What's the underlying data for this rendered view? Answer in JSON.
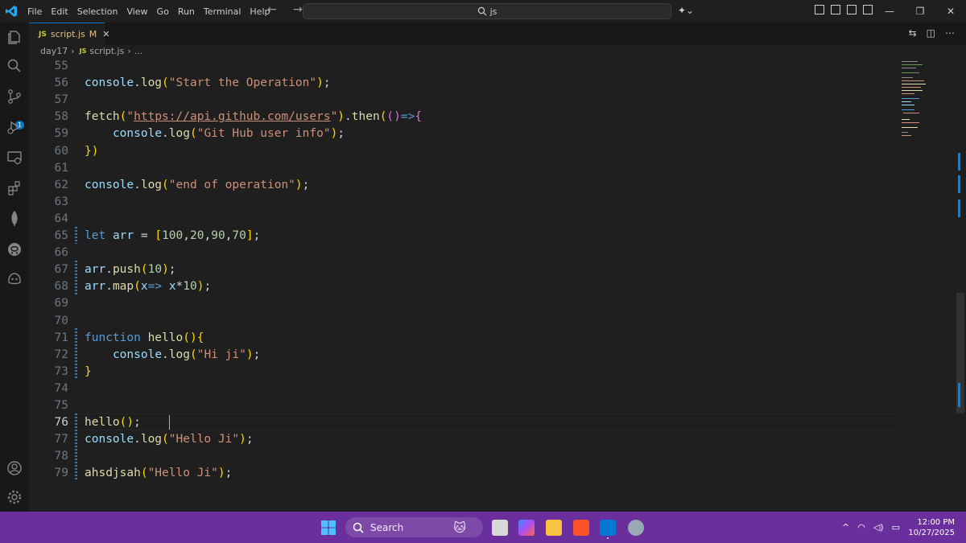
{
  "titlebar": {
    "menu": [
      "File",
      "Edit",
      "Selection",
      "View",
      "Go",
      "Run",
      "Terminal",
      "Help"
    ],
    "command_center": "js",
    "nav_arrows": "← →"
  },
  "activitybar": {
    "items": [
      "explorer-icon",
      "search-icon",
      "source-control-icon",
      "run-debug-icon",
      "remote-explorer-icon",
      "extensions-icon",
      "mongodb-icon",
      "github-icon",
      "copilot-icon"
    ],
    "scm_badge": "1",
    "bottom": [
      "account-icon",
      "settings-icon"
    ]
  },
  "tab": {
    "icon_label": "JS",
    "name": "script.js",
    "status": "M",
    "close": "✕"
  },
  "breadcrumb": {
    "folder": "day17",
    "icon_label": "JS",
    "file": "script.js",
    "more": "..."
  },
  "editor": {
    "active_line": 76,
    "lines": [
      {
        "n": 55,
        "t": ""
      },
      {
        "n": 56,
        "t": "console.log(\"Start the Operation\");"
      },
      {
        "n": 57,
        "t": ""
      },
      {
        "n": 58,
        "t": "fetch(\"https://api.github.com/users\").then(()=>{"
      },
      {
        "n": 59,
        "t": "    console.log(\"Git Hub user info\");"
      },
      {
        "n": 60,
        "t": "})"
      },
      {
        "n": 61,
        "t": ""
      },
      {
        "n": 62,
        "t": "console.log(\"end of operation\");"
      },
      {
        "n": 63,
        "t": ""
      },
      {
        "n": 64,
        "t": ""
      },
      {
        "n": 65,
        "t": "let arr = [100,20,90,70];"
      },
      {
        "n": 66,
        "t": ""
      },
      {
        "n": 67,
        "t": "arr.push(10);"
      },
      {
        "n": 68,
        "t": "arr.map(x=> x*10);"
      },
      {
        "n": 69,
        "t": ""
      },
      {
        "n": 70,
        "t": ""
      },
      {
        "n": 71,
        "t": "function hello(){"
      },
      {
        "n": 72,
        "t": "    console.log(\"Hi ji\");"
      },
      {
        "n": 73,
        "t": "}"
      },
      {
        "n": 74,
        "t": ""
      },
      {
        "n": 75,
        "t": ""
      },
      {
        "n": 76,
        "t": "hello();"
      },
      {
        "n": 77,
        "t": "console.log(\"Hello Ji\");"
      },
      {
        "n": 78,
        "t": ""
      },
      {
        "n": 79,
        "t": "ahsdjsah(\"Hello Ji\");"
      }
    ]
  },
  "taskbar": {
    "search_placeholder": "Search",
    "time": "12:00 PM",
    "date": "10/27/2025",
    "tray_chevron": "^"
  },
  "colors": {
    "accent": "#0078d4",
    "taskbar": "#6a2f9c",
    "editor_bg": "#1f1f1f",
    "keyword": "#569cd6",
    "function": "#dcdcaa",
    "string": "#ce9178",
    "number": "#b5cea8",
    "variable": "#9cdcfe"
  }
}
